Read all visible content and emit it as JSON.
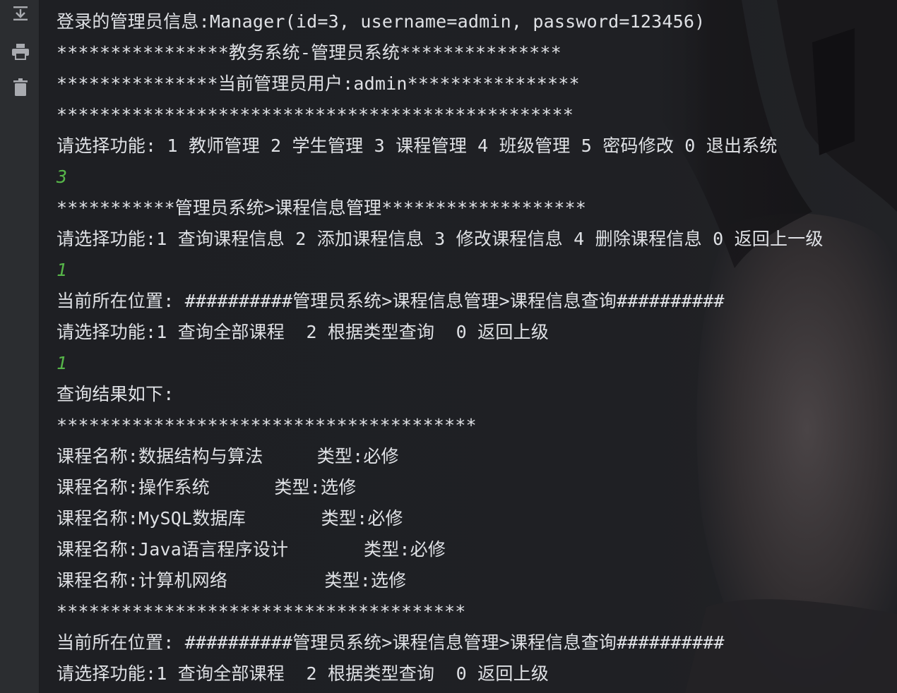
{
  "gutter": {
    "icons": [
      "download-icon",
      "print-icon",
      "trash-icon"
    ]
  },
  "colors": {
    "console_background": "#1e1f23",
    "gutter_background": "#2b2d30",
    "output_text": "#dfe1e5",
    "user_input": "#57b649",
    "error_text": "#d9534f"
  },
  "console": {
    "lines": [
      {
        "kind": "output",
        "text": "登录的管理员信息:Manager(id=3, username=admin, password=123456)"
      },
      {
        "kind": "output",
        "text": "****************教务系统-管理员系统***************"
      },
      {
        "kind": "output",
        "text": "***************当前管理员用户:admin****************"
      },
      {
        "kind": "output",
        "text": "************************************************"
      },
      {
        "kind": "output",
        "text": "请选择功能: 1 教师管理 2 学生管理 3 课程管理 4 班级管理 5 密码修改 0 退出系统"
      },
      {
        "kind": "input",
        "text": "3"
      },
      {
        "kind": "output",
        "text": "***********管理员系统>课程信息管理*******************"
      },
      {
        "kind": "output",
        "text": "请选择功能:1 查询课程信息 2 添加课程信息 3 修改课程信息 4 删除课程信息 0 返回上一级"
      },
      {
        "kind": "input",
        "text": "1"
      },
      {
        "kind": "output",
        "text": "当前所在位置: ##########管理员系统>课程信息管理>课程信息查询##########"
      },
      {
        "kind": "output",
        "text": "请选择功能:1 查询全部课程  2 根据类型查询  0 返回上级"
      },
      {
        "kind": "input",
        "text": "1"
      },
      {
        "kind": "output",
        "text": "查询结果如下:"
      },
      {
        "kind": "output",
        "text": "***************************************"
      },
      {
        "kind": "output",
        "text": "课程名称:数据结构与算法     类型:必修"
      },
      {
        "kind": "output",
        "text": "课程名称:操作系统      类型:选修"
      },
      {
        "kind": "output",
        "text": "课程名称:MySQL数据库       类型:必修"
      },
      {
        "kind": "output",
        "text": "课程名称:Java语言程序设计       类型:必修"
      },
      {
        "kind": "output",
        "text": "课程名称:计算机网络         类型:选修"
      },
      {
        "kind": "output",
        "text": "**************************************"
      },
      {
        "kind": "output",
        "text": "当前所在位置: ##########管理员系统>课程信息管理>课程信息查询##########"
      },
      {
        "kind": "output",
        "text": "请选择功能:1 查询全部课程  2 根据类型查询  0 返回上级"
      }
    ]
  }
}
